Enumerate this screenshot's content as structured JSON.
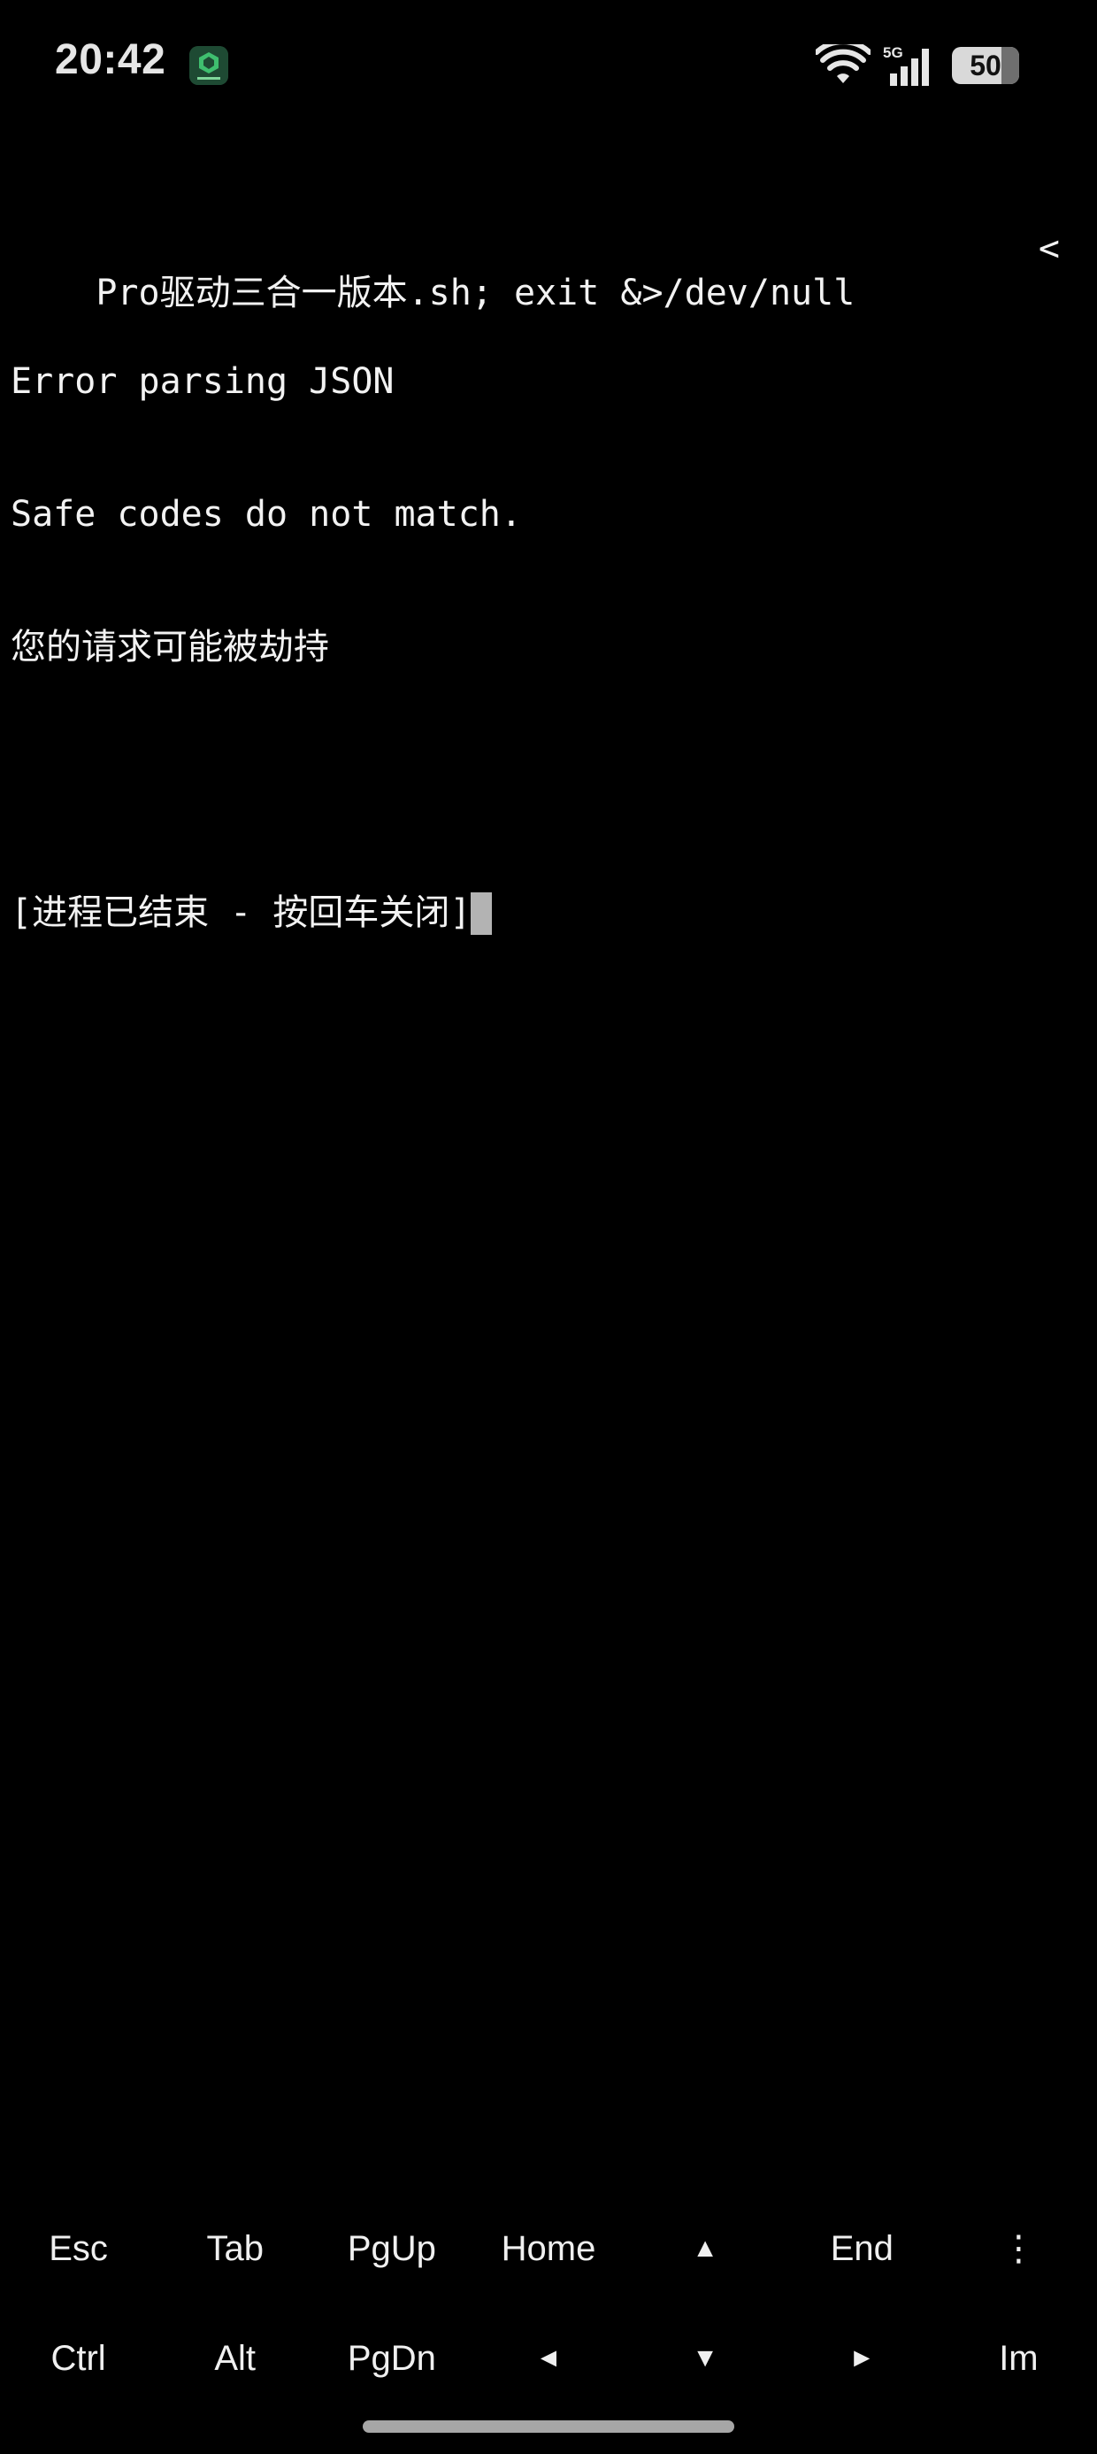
{
  "status_bar": {
    "time": "20:42",
    "network": "5G",
    "battery": "50",
    "battery_level_percent": 50,
    "notification_icon": "green-app-icon"
  },
  "terminal": {
    "lines": [
      "Pro驱动三合一版本.sh; exit &>/dev/null",
      "Error parsing JSON",
      "Safe codes do not match.",
      "您的请求可能被劫持",
      "",
      "[进程已结束 - 按回车关闭]"
    ],
    "wrap_marker": "<"
  },
  "extra_keys": {
    "row1": [
      "Esc",
      "Tab",
      "PgUp",
      "Home",
      "▲",
      "End",
      "⋮"
    ],
    "row2": [
      "Ctrl",
      "Alt",
      "PgDn",
      "◄",
      "▼",
      "►",
      "Im"
    ]
  },
  "colors": {
    "background": "#000000",
    "text": "#f2f2f2",
    "cursor": "#b3b3b3"
  }
}
